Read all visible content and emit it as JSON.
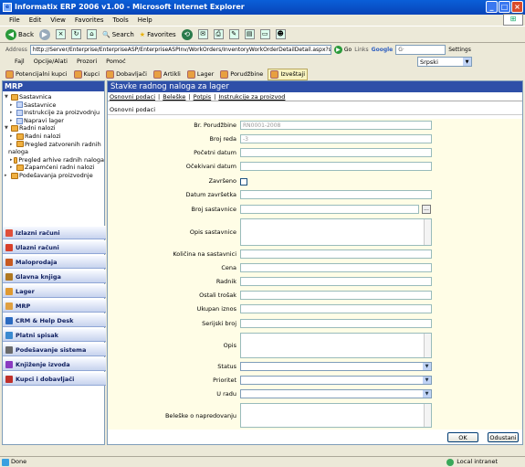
{
  "window": {
    "title": "Informatix ERP 2006 v1.00 - Microsoft Internet Explorer"
  },
  "menu": [
    "File",
    "Edit",
    "View",
    "Favorites",
    "Tools",
    "Help"
  ],
  "toolbar": {
    "back": "Back",
    "search": "Search",
    "favorites": "Favorites"
  },
  "address": {
    "label": "Address",
    "url": "http://Server/Enterprise/EnterpriseASP/EnterpriseASPInv/WorkOrders/InventoryWorkOrderDetailDetail.aspx?state=9",
    "go": "Go",
    "links": "Links",
    "google": "Google",
    "settings": "Settings"
  },
  "app_menu": [
    "Fajl",
    "Opcije/Alati",
    "Prozori",
    "Pomoć"
  ],
  "language": "Srpski",
  "quickbar": [
    "Potencijalni kupci",
    "Kupci",
    "Dobavljači",
    "Artikli",
    "Lager",
    "Porudžbine",
    "Izveštaji"
  ],
  "left": {
    "header": "MRP",
    "tree": [
      {
        "label": "Sastavnica",
        "level": 0,
        "type": "folder"
      },
      {
        "label": "Sastavnice",
        "level": 1,
        "type": "doc"
      },
      {
        "label": "Instrukcije za proizvodnju",
        "level": 1,
        "type": "doc"
      },
      {
        "label": "Napravi lager",
        "level": 1,
        "type": "doc"
      },
      {
        "label": "Radni nalozi",
        "level": 0,
        "type": "folder"
      },
      {
        "label": "Radni nalozi",
        "level": 1,
        "type": "doc"
      },
      {
        "label": "Pregled zatvorenih radnih",
        "level": 1,
        "type": "doc"
      },
      {
        "label": "naloga",
        "level": 1,
        "type": "cont"
      },
      {
        "label": "Pregled arhive radnih naloga",
        "level": 1,
        "type": "doc"
      },
      {
        "label": "Zapamćeni radni nalozi",
        "level": 1,
        "type": "doc"
      },
      {
        "label": "Podešavanja proizvodnje",
        "level": 0,
        "type": "folder"
      }
    ],
    "modules": [
      "Izlazni računi",
      "Ulazni računi",
      "Maloprodaja",
      "Glavna knjiga",
      "Lager",
      "MRP",
      "CRM & Help Desk",
      "Platni spisak",
      "Podešavanje sistema",
      "Knjiženje izvoda",
      "Kupci i dobavljači"
    ]
  },
  "main": {
    "title": "Stavke radnog naloga za lager",
    "tabs": [
      "Osnovni podaci",
      "Beleške",
      "Potpis",
      "Instrukcije za proizvod"
    ],
    "section": "Osnovni podaci",
    "fields": {
      "br_porudzbine": {
        "label": "Br. Porudžbine",
        "value": "RN0001-2008"
      },
      "broj_reda": {
        "label": "Broj reda",
        "value": "-3"
      },
      "pocetni_datum": {
        "label": "Početni datum",
        "value": ""
      },
      "ocekivani_datum": {
        "label": "Očekivani datum",
        "value": ""
      },
      "zavrseno": {
        "label": "Završeno"
      },
      "datum_zavrsetka": {
        "label": "Datum završetka",
        "value": ""
      },
      "broj_sastavnice": {
        "label": "Broj sastavnice",
        "value": "",
        "button": "..."
      },
      "opis_sastavnice": {
        "label": "Opis sastavnice"
      },
      "kolicina": {
        "label": "Količina na sastavnici",
        "value": ""
      },
      "cena": {
        "label": "Cena",
        "value": ""
      },
      "radnik": {
        "label": "Radnik",
        "value": ""
      },
      "ostali_trosak": {
        "label": "Ostali trošak",
        "value": ""
      },
      "ukupan_iznos": {
        "label": "Ukupan iznos",
        "value": ""
      },
      "serijski_broj": {
        "label": "Serijski broj",
        "value": ""
      },
      "opis": {
        "label": "Opis"
      },
      "status": {
        "label": "Status"
      },
      "prioritet": {
        "label": "Prioritet"
      },
      "u_radu": {
        "label": "U radu"
      },
      "beleske": {
        "label": "Beleške o napredovanju"
      }
    },
    "ok": "OK",
    "cancel": "Odustani"
  },
  "statusbar": {
    "left": "Done",
    "zone": "Local intranet"
  }
}
